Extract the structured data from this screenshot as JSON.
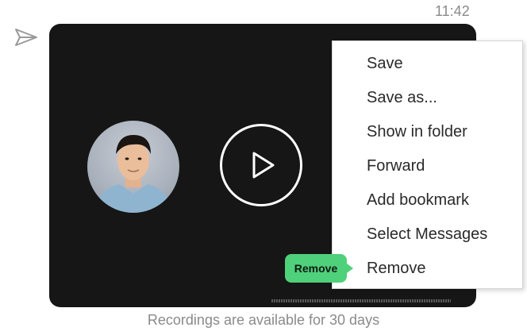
{
  "message": {
    "time": "11:42",
    "note": "Recordings are available for 30 days"
  },
  "context_menu": {
    "items": [
      "Save",
      "Save as...",
      "Show in folder",
      "Forward",
      "Add bookmark",
      "Select Messages",
      "Remove"
    ]
  },
  "tooltip": {
    "label": "Remove"
  },
  "colors": {
    "card_background": "#161616",
    "tooltip_background": "#4fd07a",
    "menu_background": "#ffffff",
    "muted_text": "#8a8a8a"
  },
  "icons": {
    "sent_status": "send-icon",
    "play": "play-icon"
  }
}
